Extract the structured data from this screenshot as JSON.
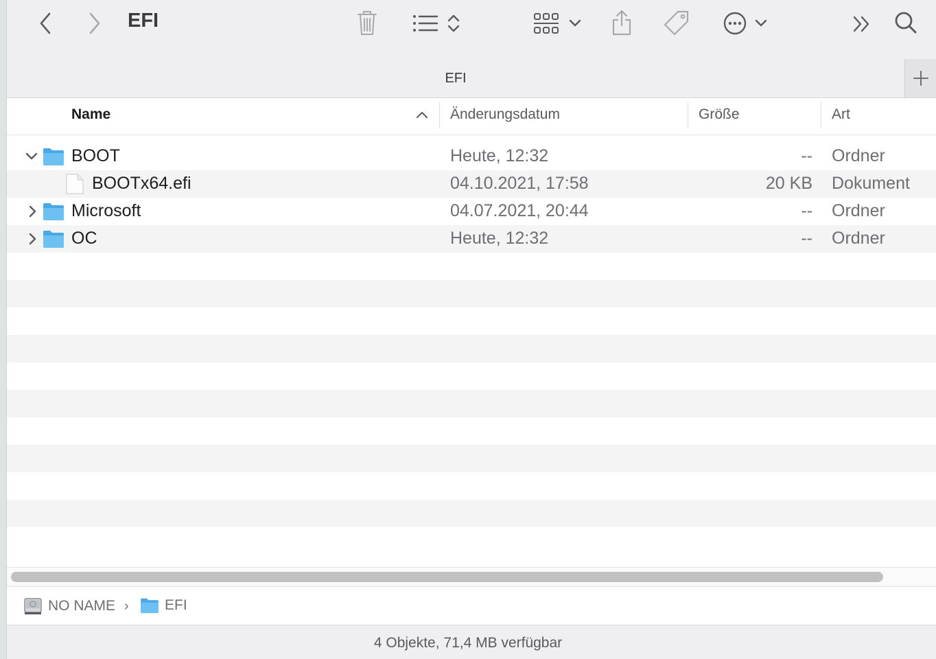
{
  "window": {
    "title": "EFI"
  },
  "tabbar": {
    "tab_label": "EFI",
    "add_tab_icon": "plus-icon"
  },
  "toolbar": {
    "icons": [
      "chevron-left-icon",
      "chevron-right-icon",
      "trash-icon",
      "list-view-icon",
      "sort-updown-icon",
      "grid-view-icon",
      "chevron-down-icon",
      "share-icon",
      "tag-icon",
      "more-ellipsis-icon",
      "chevron-down-icon",
      "double-chevron-right-icon",
      "search-icon"
    ]
  },
  "columns": {
    "name": "Name",
    "date": "Änderungsdatum",
    "size": "Größe",
    "kind": "Art"
  },
  "rows": [
    {
      "name": "BOOT",
      "date": "Heute, 12:32",
      "size": "--",
      "kind": "Ordner",
      "type": "folder",
      "expanded": true
    },
    {
      "name": "BOOTx64.efi",
      "date": "04.10.2021, 17:58",
      "size": "20 KB",
      "kind": "Dokument",
      "type": "file",
      "indent": 1
    },
    {
      "name": "Microsoft",
      "date": "04.07.2021, 20:44",
      "size": "--",
      "kind": "Ordner",
      "type": "folder",
      "expanded": false
    },
    {
      "name": "OC",
      "date": "Heute, 12:32",
      "size": "--",
      "kind": "Ordner",
      "type": "folder",
      "expanded": false
    }
  ],
  "pathbar": {
    "items": [
      {
        "label": "NO NAME",
        "icon": "disk-icon"
      },
      {
        "label": "EFI",
        "icon": "folder-icon"
      }
    ],
    "separator": "›"
  },
  "status": {
    "text": "4 Objekte, 71,4 MB verfügbar"
  },
  "colors": {
    "folder": "#5ab4ec",
    "toolbar_bg": "#efeff1",
    "alt_row": "#f4f4f5",
    "icon": "#6e6e73"
  }
}
